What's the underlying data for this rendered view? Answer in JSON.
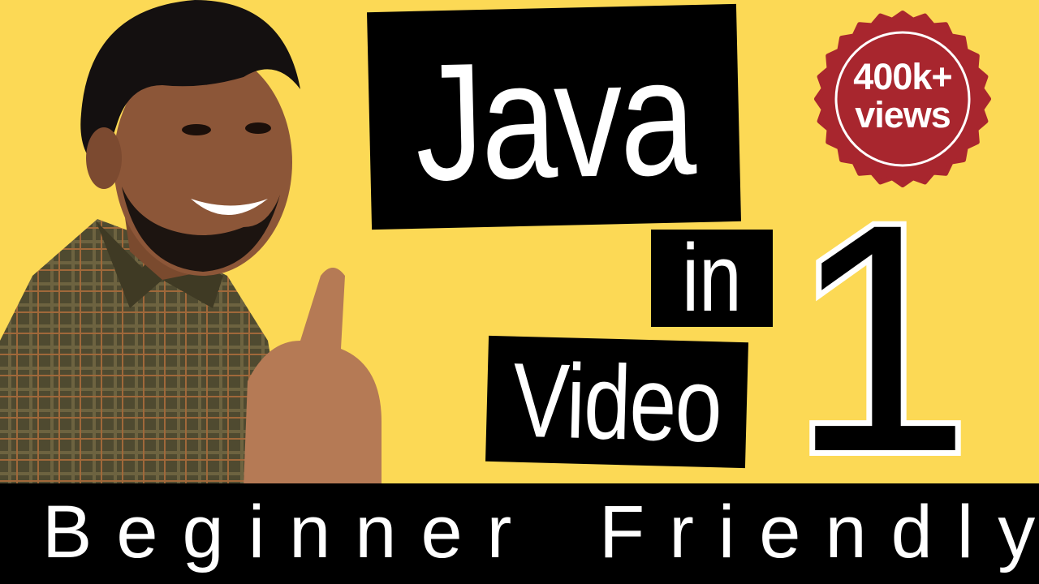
{
  "title": {
    "word1": "Java",
    "word2": "in",
    "word3": "Video",
    "number": "1"
  },
  "badge": {
    "line1": "400k+",
    "line2": "views"
  },
  "banner": {
    "left": "Beginner",
    "right": "Friendly"
  },
  "colors": {
    "background": "#fcd955",
    "badge": "#a8262e",
    "box": "#000000",
    "text": "#ffffff"
  }
}
